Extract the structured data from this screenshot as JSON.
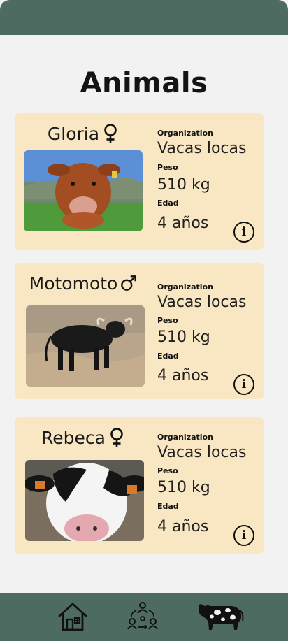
{
  "page": {
    "title": "Animals"
  },
  "labels": {
    "organization": "Organization",
    "weight": "Peso",
    "age": "Edad",
    "info": "i"
  },
  "animals": [
    {
      "name": "Gloria",
      "sex": "female",
      "organization": "Vacas locas",
      "weight": "510 kg",
      "age": "4 años"
    },
    {
      "name": "Motomoto",
      "sex": "male",
      "organization": "Vacas locas",
      "weight": "510 kg",
      "age": "4 años"
    },
    {
      "name": "Rebeca",
      "sex": "female",
      "organization": "Vacas locas",
      "weight": "510 kg",
      "age": "4 años"
    }
  ],
  "nav": {
    "items": [
      {
        "icon": "home-icon"
      },
      {
        "icon": "community-icon"
      },
      {
        "icon": "cow-icon"
      }
    ]
  },
  "colors": {
    "bar": "#4e6b62",
    "card": "#f8e7c2",
    "background": "#f2f2f2"
  }
}
